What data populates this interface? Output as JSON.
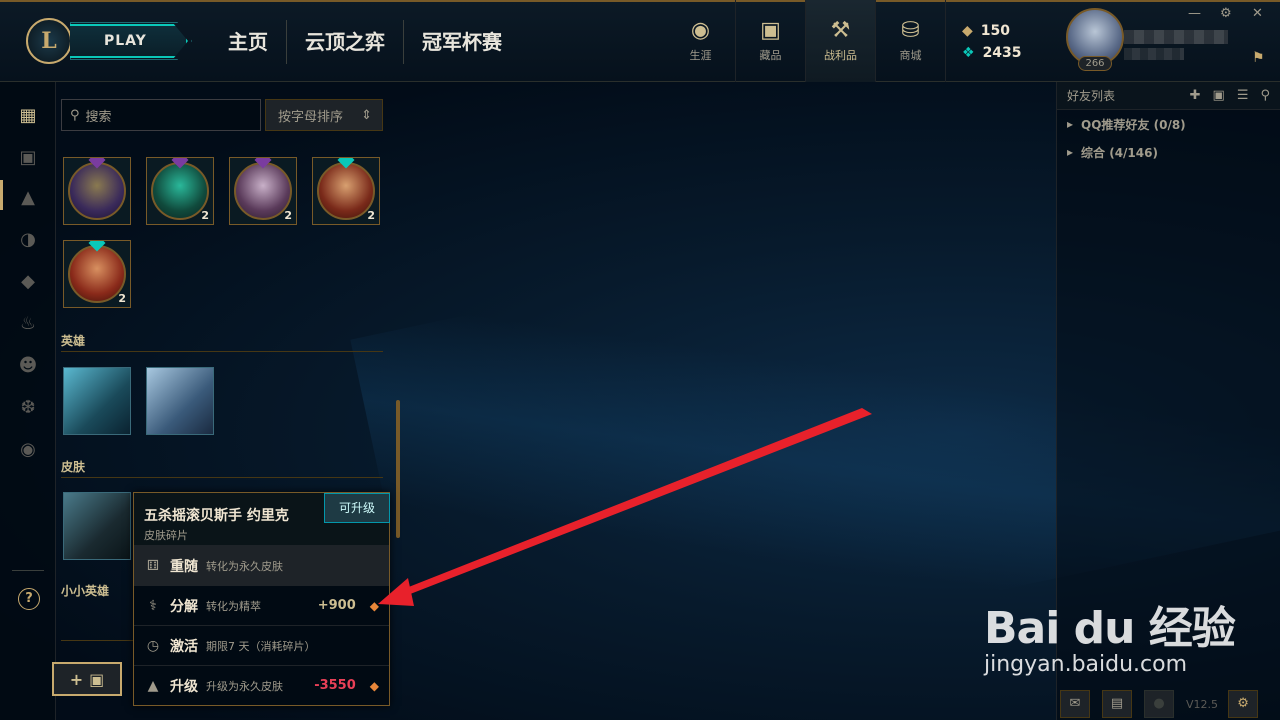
{
  "app": {
    "logo_letter": "L",
    "play_label": "PLAY"
  },
  "nav": {
    "links": [
      "主页",
      "云顶之弈",
      "冠军杯赛"
    ]
  },
  "nav_icons": [
    {
      "label": "生涯",
      "icon": "profile-icon"
    },
    {
      "label": "藏品",
      "icon": "collection-icon"
    },
    {
      "label": "战利品",
      "icon": "loot-icon",
      "active": true
    },
    {
      "label": "商城",
      "icon": "store-icon"
    }
  ],
  "currency": {
    "blue_essence": "150",
    "riot_points": "2435"
  },
  "profile": {
    "level": "266"
  },
  "search": {
    "placeholder": "搜索"
  },
  "sort": {
    "label": "按字母排序"
  },
  "tiles_row1_counts": [
    "",
    "2",
    "2",
    "2"
  ],
  "tiles_row2_counts": [
    "2"
  ],
  "sections": {
    "champions": "英雄",
    "skins": "皮肤",
    "little_legends": "小小英雄"
  },
  "popup": {
    "title": "五杀摇滚贝斯手 约里克",
    "subtitle": "皮肤碎片",
    "badge": "可升级",
    "options": [
      {
        "name": "重随",
        "desc": "转化为永久皮肤",
        "value": ""
      },
      {
        "name": "分解",
        "desc": "转化为精萃",
        "value": "+900"
      },
      {
        "name": "激活",
        "desc": "期限7 天（消耗碎片）",
        "value": ""
      },
      {
        "name": "升级",
        "desc": "升级为永久皮肤",
        "value": "-3550"
      }
    ]
  },
  "friends": {
    "title": "好友列表",
    "groups": [
      "QQ推荐好友 (0/8)",
      "综合 (4/146)"
    ]
  },
  "footer": {
    "version": "V12.5"
  },
  "watermark": {
    "brand": "Bai du 经验",
    "url": "jingyan.baidu.com"
  },
  "colors": {
    "gold": "#c8aa6e",
    "teal": "#0ac8b9",
    "arrow": "#e8212b",
    "negative": "#e84057"
  }
}
